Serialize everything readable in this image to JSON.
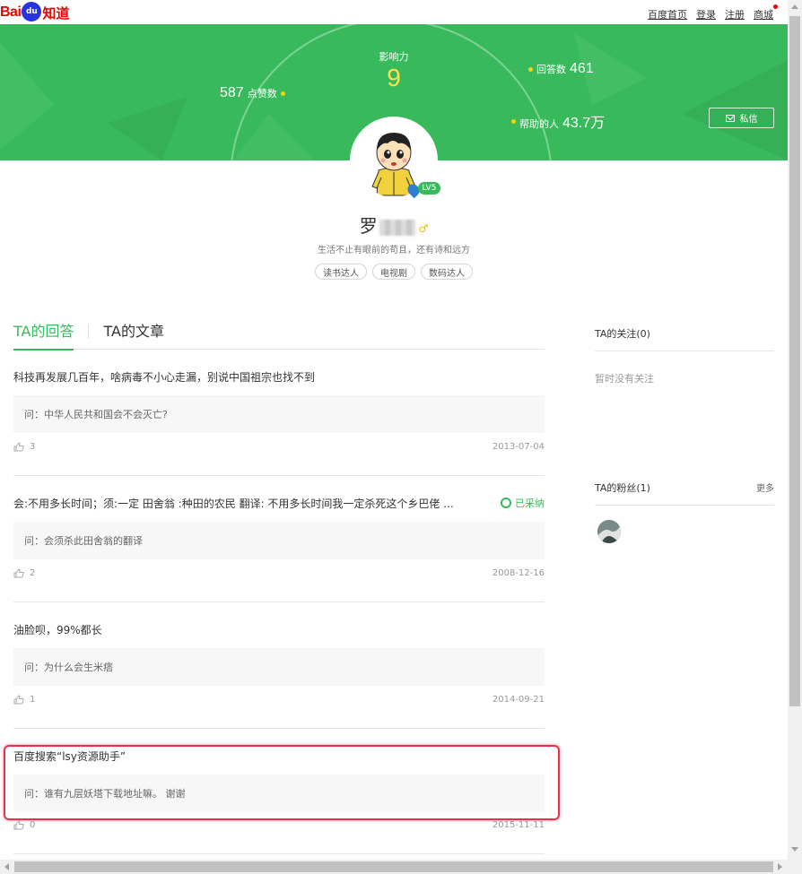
{
  "header": {
    "logo_text_bai": "Bai",
    "logo_paw_text": "du",
    "logo_text_zhidao": "知道",
    "links": [
      "百度首页",
      "登录",
      "注册",
      "商城"
    ]
  },
  "banner": {
    "influence_label": "影响力",
    "influence_value": "9",
    "likes": {
      "value": "587",
      "label": "点赞数"
    },
    "answers": {
      "label": "回答数",
      "value": "461"
    },
    "helped": {
      "label": "帮助的人",
      "value": "43.7万"
    },
    "message_button": "私信",
    "bg_color": "#38ba5c"
  },
  "profile": {
    "name": "罗",
    "gender_symbol": "♂",
    "level": "LV5",
    "motto": "生活不止有眼前的苟且，还有诗和远方",
    "tags": [
      "读书达人",
      "电视剧",
      "数码达人"
    ]
  },
  "tabs": [
    "TA的回答",
    "TA的文章"
  ],
  "answers": [
    {
      "title": "科技再发展几百年，啥病毒不小心走漏，别说中国祖宗也找不到",
      "question": "问：中华人民共和国会不会灭亡?",
      "likes": "3",
      "date": "2013-07-04",
      "adopted": ""
    },
    {
      "title": "会:不用多长时间；须:一定 田舍翁 :种田的农民 翻译: 不用多长时间我一定杀死这个乡巴佬 ...",
      "question": "问：会须杀此田舍翁的翻译",
      "likes": "2",
      "date": "2008-12-16",
      "adopted": "已采纳"
    },
    {
      "title": "油脸呗，99%都长",
      "question": "问：为什么会生米痞",
      "likes": "1",
      "date": "2014-09-21",
      "adopted": ""
    },
    {
      "title": "百度搜索“lsy资源助手”",
      "question": "问：谁有九层妖塔下载地址嘛。 谢谢",
      "likes": "0",
      "date": "2015-11-11",
      "adopted": ""
    }
  ],
  "sidebar": {
    "following_title": "TA的关注(0)",
    "following_empty": "暂时没有关注",
    "fans_title": "TA的粉丝(1)",
    "fans_more": "更多"
  }
}
